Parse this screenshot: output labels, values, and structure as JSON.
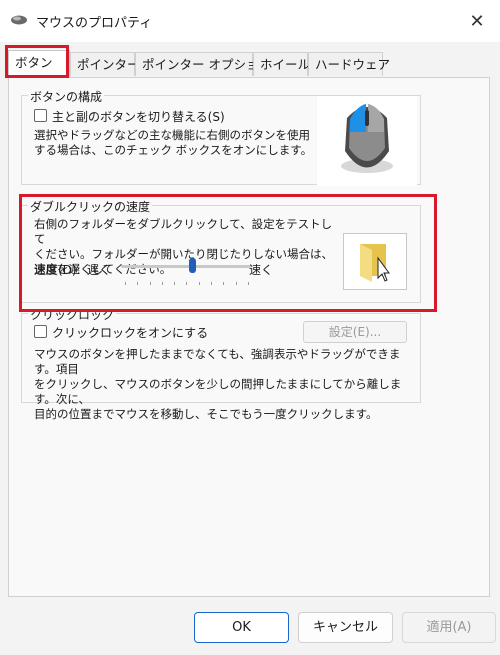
{
  "window": {
    "title": "マウスのプロパティ",
    "close_glyph": "✕"
  },
  "tabs": [
    {
      "label": "ボタン",
      "active": true
    },
    {
      "label": "ポインター",
      "active": false
    },
    {
      "label": "ポインター オプション",
      "active": false
    },
    {
      "label": "ホイール",
      "active": false
    },
    {
      "label": "ハードウェア",
      "active": false
    }
  ],
  "button_config": {
    "title": "ボタンの構成",
    "checkbox_label": "主と副のボタンを切り替える(S)",
    "checked": false,
    "description_line1": "選択やドラッグなどの主な機能に右側のボタンを使用",
    "description_line2": "する場合は、このチェック ボックスをオンにします。"
  },
  "double_click": {
    "title": "ダブルクリックの速度",
    "description_line1": "右側のフォルダーをダブルクリックして、設定をテストして",
    "description_line2": "ください。フォルダーが開いたり閉じたりしない場合は、",
    "description_line3": "速度を遅くしてください。",
    "speed_label": "速度(D):",
    "slow_label": "遅く",
    "fast_label": "速く",
    "speed_value_fraction": 0.55
  },
  "click_lock": {
    "title": "クリックロック",
    "checkbox_label": "クリックロックをオンにする",
    "checked": false,
    "settings_label": "設定(E)...",
    "description_line1": "マウスのボタンを押したままでなくても、強調表示やドラッグができます。項目",
    "description_line2": "をクリックし、マウスのボタンを少しの間押したままにしてから離します。次に、",
    "description_line3": "目的の位置までマウスを移動し、そこでもう一度クリックします。"
  },
  "footer": {
    "ok_label": "OK",
    "cancel_label": "キャンセル",
    "apply_label": "適用(A)"
  },
  "colors": {
    "highlight_red": "#d6192b",
    "accent_blue": "#1f5fb8",
    "mouse_blue": "#1e90e8"
  }
}
